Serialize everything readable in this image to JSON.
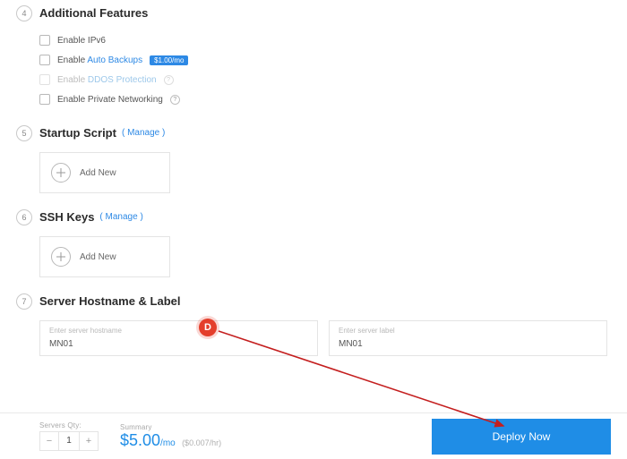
{
  "sections": {
    "additional_features": {
      "step": "4",
      "title": "Additional Features",
      "items": {
        "ipv6": {
          "prefix": "Enable ",
          "label": "IPv6"
        },
        "backup": {
          "prefix": "Enable ",
          "link": "Auto Backups",
          "badge": "$1.00/mo"
        },
        "ddos": {
          "prefix": "Enable ",
          "link": "DDOS Protection"
        },
        "pnw": {
          "prefix": "Enable ",
          "label": "Private Networking"
        }
      }
    },
    "startup_script": {
      "step": "5",
      "title": "Startup Script",
      "manage": "( Manage )",
      "add_new": "Add New"
    },
    "ssh_keys": {
      "step": "6",
      "title": "SSH Keys",
      "manage": "( Manage )",
      "add_new": "Add New"
    },
    "hostname": {
      "step": "7",
      "title": "Server Hostname & Label",
      "hostname_ph": "Enter server hostname",
      "hostname_val": "MN01",
      "label_ph": "Enter server label",
      "label_val": "MN01"
    }
  },
  "annotation": {
    "badge": "D"
  },
  "footer": {
    "qty_label": "Servers Qty:",
    "qty_value": "1",
    "summary_label": "Summary",
    "price": "$5.00",
    "per_month": "/mo",
    "per_hour": "($0.007/hr)",
    "deploy": "Deploy Now"
  },
  "glyphs": {
    "question": "?",
    "minus": "−",
    "plus": "+"
  }
}
